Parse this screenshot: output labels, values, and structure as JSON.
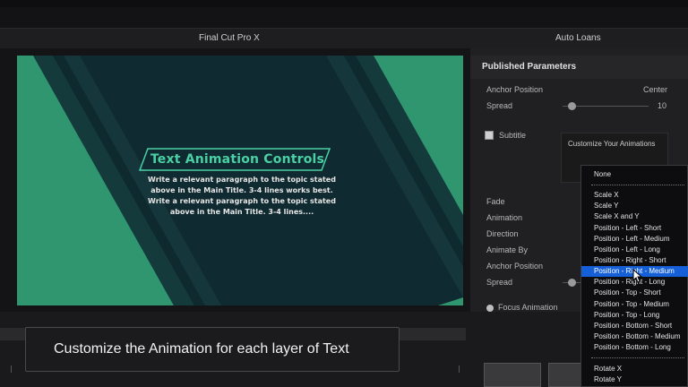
{
  "window": {
    "app_title": "Final Cut Pro X",
    "document_title": "Auto Loans"
  },
  "viewer": {
    "title_text": "Text Animation Controls",
    "body_lines": [
      "Write a relevant paragraph to the topic stated",
      "above in the Main Title. 3-4 lines works best.",
      "Write a relevant paragraph to the topic stated",
      "above in the Main Title. 3-4 lines...."
    ],
    "colors": {
      "accent_green": "#4ad0a4",
      "panel_green": "#2f9670",
      "dark_teal": "#102a31"
    }
  },
  "inspector": {
    "title": "Published Parameters",
    "anchor_position_label": "Anchor Position",
    "anchor_position_value": "Center",
    "spread_label": "Spread",
    "spread_value": "10",
    "subtitle_label": "Subtitle",
    "rows": [
      "Fade",
      "Animation",
      "Direction",
      "Animate By",
      "Anchor Position",
      "Spread"
    ],
    "focus_animation_label": "Focus Animation"
  },
  "tooltip": {
    "text": "Customize Your Animations"
  },
  "dropdown": {
    "items": [
      "None",
      "Scale X",
      "Scale Y",
      "Scale X and Y",
      "Position - Left - Short",
      "Position - Left - Medium",
      "Position - Left - Long",
      "Position - Right - Short",
      "Position - Right - Medium",
      "Position - Right - Long",
      "Position - Top - Short",
      "Position - Top - Medium",
      "Position - Top - Long",
      "Position - Bottom - Short",
      "Position - Bottom - Medium",
      "Position - Bottom - Long",
      "Rotate X",
      "Rotate Y"
    ],
    "selected": "Position - Right - Medium",
    "highlight_color": "#1560d8"
  },
  "caption": {
    "text": "Customize the Animation for each layer of Text"
  }
}
